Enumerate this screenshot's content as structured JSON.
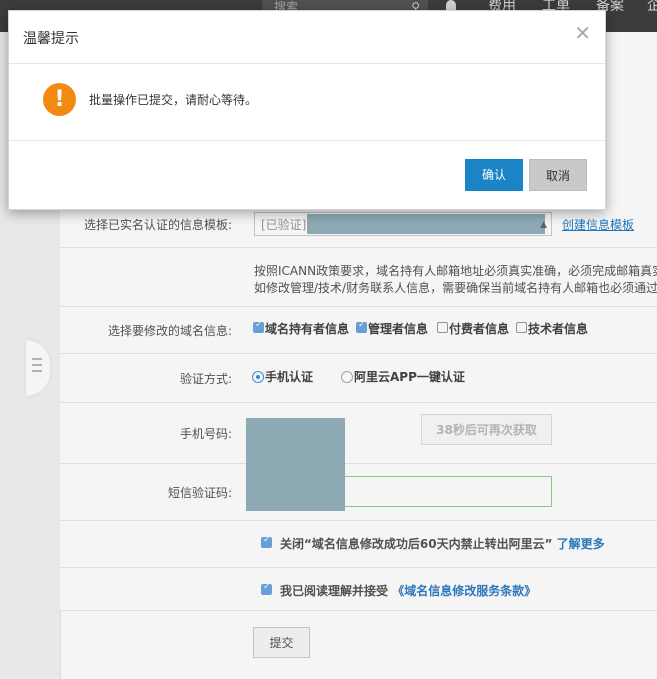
{
  "topbar": {
    "search_placeholder": "搜索",
    "nav": [
      "费用",
      "工单",
      "备案",
      "企"
    ]
  },
  "form": {
    "template_label": "选择已实名认证的信息模板:",
    "template_value": "[已验证]",
    "create_template_link": "创建信息模板",
    "notice_line1": "按照ICANN政策要求，域名持有人邮箱地址必须真实准确，必须完成邮箱真实",
    "notice_line2": "如修改管理/技术/财务联系人信息，需要确保当前域名持有人邮箱也必须通过",
    "modify_label": "选择要修改的域名信息:",
    "options": [
      {
        "label": "域名持有者信息",
        "checked": true
      },
      {
        "label": "管理者信息",
        "checked": true
      },
      {
        "label": "付费者信息",
        "checked": false
      },
      {
        "label": "技术者信息",
        "checked": false
      }
    ],
    "verify_label": "验证方式:",
    "verify_options": [
      {
        "label": "手机认证",
        "selected": true
      },
      {
        "label": "阿里云APP一键认证",
        "selected": false
      }
    ],
    "phone_label": "手机号码:",
    "retry_button": "38秒后可再次获取",
    "sms_label": "短信验证码:",
    "agree1_text": "关闭“域名信息修改成功后60天内禁止转出阿里云”",
    "agree1_link": "了解更多",
    "agree2_text": "我已阅读理解并接受",
    "agree2_link": "《域名信息修改服务条款》",
    "submit_button": "提交"
  },
  "modal": {
    "title": "温馨提示",
    "icon": "warning-icon",
    "message": "批量操作已提交，请耐心等待。",
    "confirm_button": "确认",
    "cancel_button": "取消"
  },
  "colors": {
    "accent": "#1b84c6",
    "warning": "#f28a12",
    "topbar": "#3f3f41",
    "mask": "#93b1bc"
  }
}
